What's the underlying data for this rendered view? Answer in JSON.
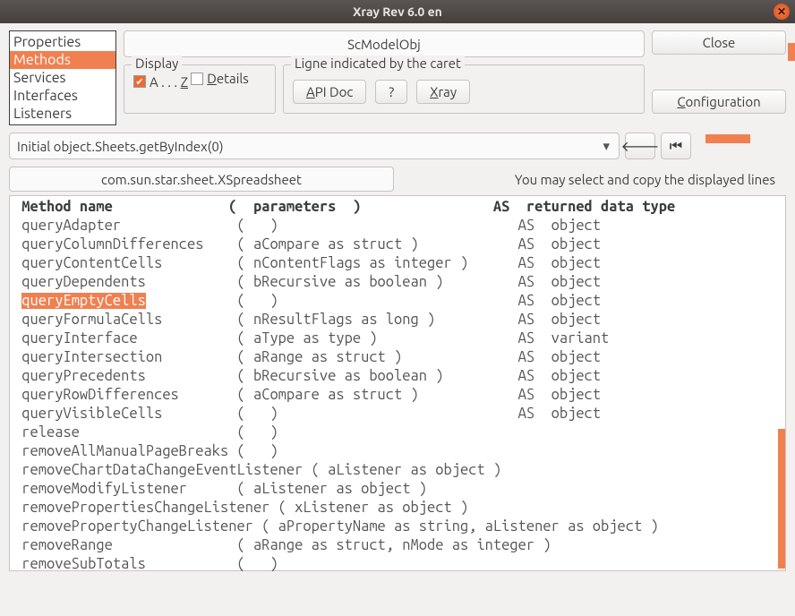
{
  "window": {
    "title": "Xray   Rev 6.0 en"
  },
  "tabs": {
    "items": [
      "Properties",
      "Methods",
      "Services",
      "Interfaces",
      "Listeners"
    ],
    "selected": 1
  },
  "object_name": "ScModelObj",
  "buttons": {
    "close": "Close",
    "configuration": "Configuration",
    "api_doc": "API Doc",
    "qmark": "?",
    "xray": "Xray"
  },
  "display": {
    "legend": "Display",
    "az_label": "A . . . Z",
    "az_checked": true,
    "details_label": "Details",
    "details_checked": false
  },
  "caret": {
    "legend": "Ligne indicated by the caret"
  },
  "combo": {
    "value": "Initial object.Sheets.getByIndex(0)"
  },
  "interface_box": "com.sun.star.sheet.XSpreadsheet",
  "hint": "You may select and copy the displayed lines",
  "header": " Method name              (  parameters  )                AS  returned data type",
  "methods": [
    {
      "name": "queryAdapter",
      "params": "(   )",
      "ret": "AS  object"
    },
    {
      "name": "queryColumnDifferences",
      "params": "( aCompare as struct )",
      "ret": "AS  object"
    },
    {
      "name": "queryContentCells",
      "params": "( nContentFlags as integer )",
      "ret": "AS  object"
    },
    {
      "name": "queryDependents",
      "params": "( bRecursive as boolean )",
      "ret": "AS  object"
    },
    {
      "name": "queryEmptyCells",
      "params": "(   )",
      "ret": "AS  object",
      "sel": true
    },
    {
      "name": "queryFormulaCells",
      "params": "( nResultFlags as long )",
      "ret": "AS  object"
    },
    {
      "name": "queryInterface",
      "params": "( aType as type )",
      "ret": "AS  variant"
    },
    {
      "name": "queryIntersection",
      "params": "( aRange as struct )",
      "ret": "AS  object"
    },
    {
      "name": "queryPrecedents",
      "params": "( bRecursive as boolean )",
      "ret": "AS  object"
    },
    {
      "name": "queryRowDifferences",
      "params": "( aCompare as struct )",
      "ret": "AS  object"
    },
    {
      "name": "queryVisibleCells",
      "params": "(   )",
      "ret": "AS  object"
    },
    {
      "name": "release",
      "params": "(   )",
      "ret": ""
    },
    {
      "name": "removeAllManualPageBreaks",
      "params": "(   )",
      "ret": ""
    },
    {
      "name": "removeChartDataChangeEventListener",
      "params": "( aListener as object )",
      "ret": "",
      "wide": true
    },
    {
      "name": "removeModifyListener",
      "params": "( aListener as object )",
      "ret": ""
    },
    {
      "name": "removePropertiesChangeListener",
      "params": "( xListener as object )",
      "ret": "",
      "wide": true
    },
    {
      "name": "removePropertyChangeListener",
      "params": "( aPropertyName as string, aListener as object )",
      "ret": "",
      "wide": true
    },
    {
      "name": "removeRange",
      "params": "( aRange as struct, nMode as integer )",
      "ret": ""
    },
    {
      "name": "removeSubTotals",
      "params": "(   )",
      "ret": ""
    }
  ]
}
